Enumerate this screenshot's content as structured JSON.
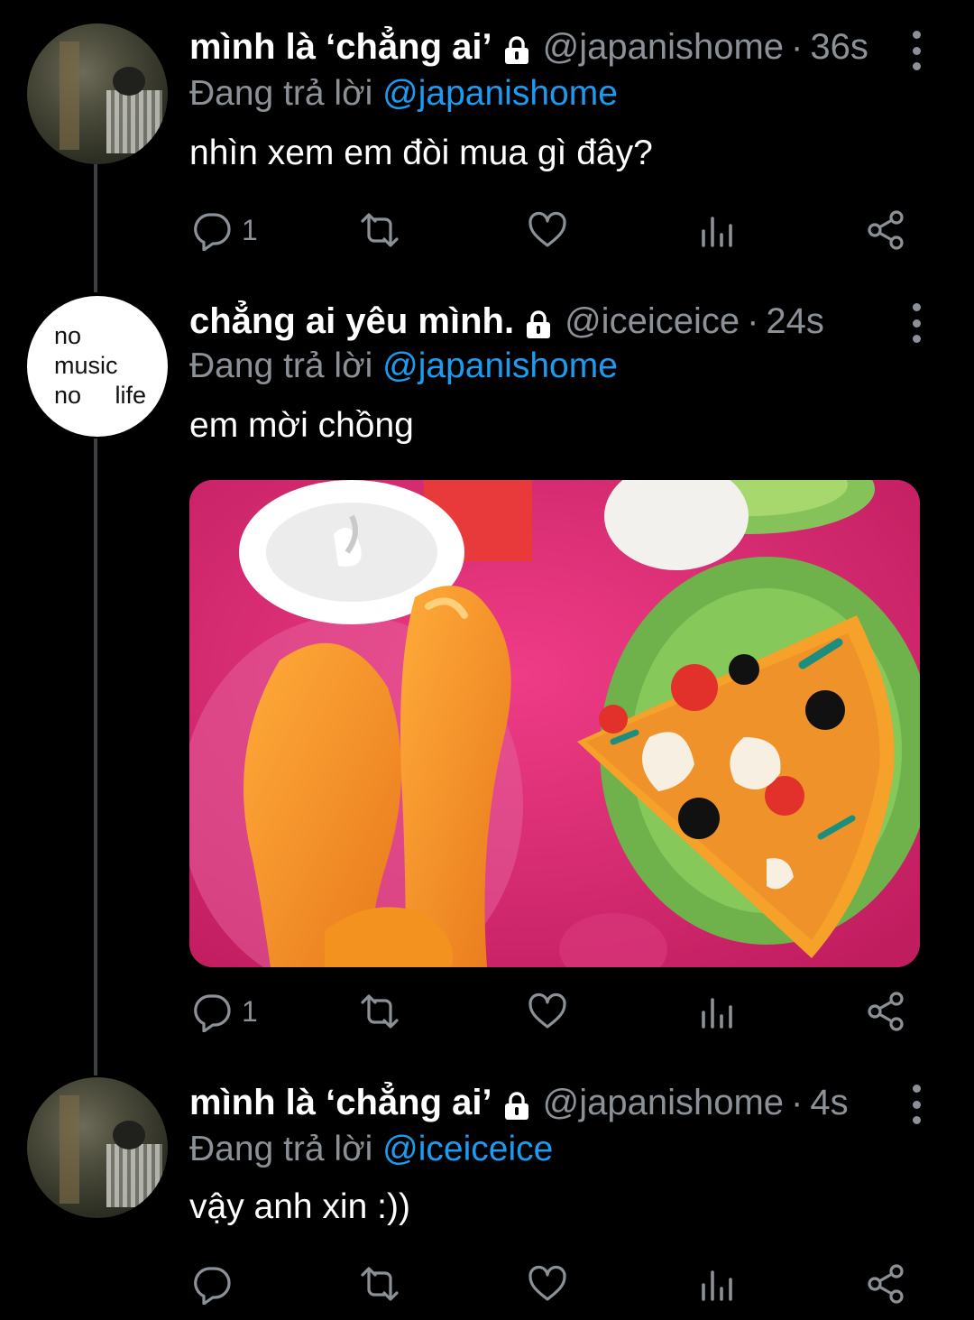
{
  "tweets": [
    {
      "name": "mình là ‘chẳng ai’",
      "handle": "@japanishome",
      "separator": "·",
      "time": "36s",
      "replying_prefix": "Đang trả lời",
      "replying_to": "@japanishome",
      "text": "nhìn xem em đòi mua gì đây?",
      "reply_count": "1",
      "avatar_icon": "photo-avatar"
    },
    {
      "name": "chẳng ai yêu mình.",
      "handle": "@iceiceice",
      "separator": "·",
      "time": "24s",
      "replying_prefix": "Đang trả lời",
      "replying_to": "@japanishome",
      "text": "em mời chồng",
      "reply_count": "1",
      "avatar_lines": [
        "no",
        "music",
        "no     life"
      ],
      "media_icon": "toy-food-photo"
    },
    {
      "name": "mình là ‘chẳng ai’",
      "handle": "@japanishome",
      "separator": "·",
      "time": "4s",
      "replying_prefix": "Đang trả lời",
      "replying_to": "@iceiceice",
      "text": "vậy anh xin :))",
      "reply_count": "",
      "avatar_icon": "photo-avatar"
    }
  ],
  "icons": {
    "reply": "reply-icon",
    "retweet": "retweet-icon",
    "like": "like-icon",
    "views": "views-icon",
    "share": "share-icon",
    "lock": "lock-icon",
    "more": "more-icon"
  },
  "colors": {
    "background": "#000000",
    "muted": "#8b9197",
    "accent": "#1d9bf0",
    "thread_line": "#3d4043"
  }
}
